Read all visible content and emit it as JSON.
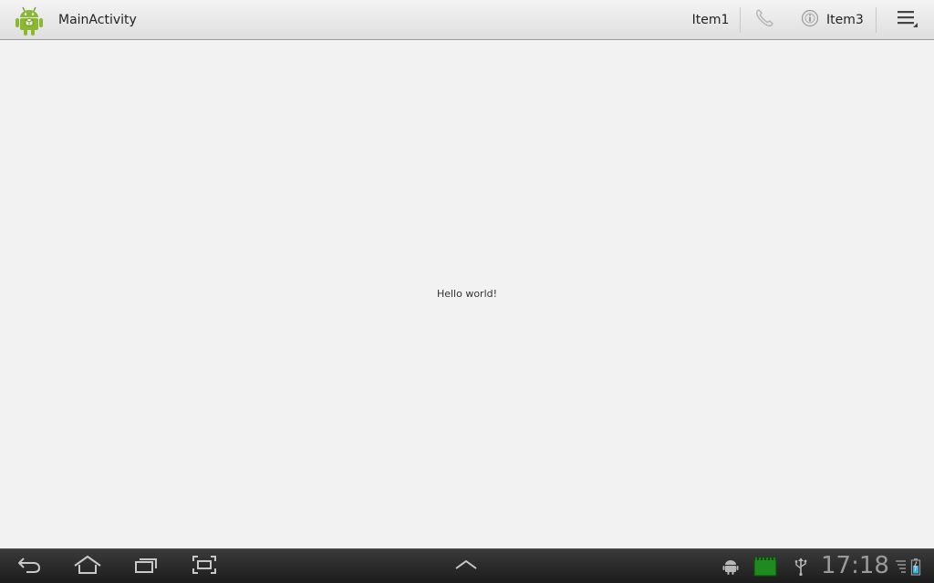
{
  "action_bar": {
    "title": "MainActivity",
    "icon": "android-robot-icon",
    "items": [
      {
        "label": "Item1"
      },
      {
        "label": "",
        "icon": "phone-icon"
      },
      {
        "label": "Item3",
        "icon": "info-icon"
      }
    ],
    "overflow_icon": "overflow-menu-icon"
  },
  "content": {
    "text": "Hello world!"
  },
  "system_bar": {
    "nav": [
      "back-icon",
      "home-icon",
      "recent-apps-icon",
      "screenshot-icon"
    ],
    "center": "chevron-up-icon",
    "status_icons": [
      "android-debug-icon",
      "image-notification-icon",
      "usb-icon"
    ],
    "time": "17:18",
    "tray": [
      "wifi-signal-icon",
      "battery-icon"
    ]
  },
  "colors": {
    "accent": "#33b5e5",
    "android_green": "#8ab832"
  }
}
